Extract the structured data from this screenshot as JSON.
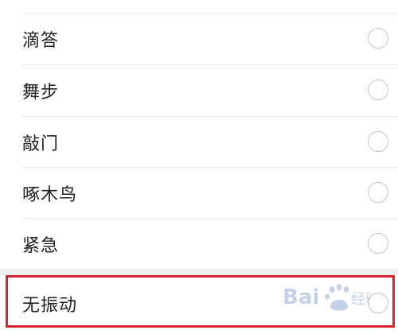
{
  "vibration_options": [
    {
      "label": "滴答",
      "selected": false
    },
    {
      "label": "舞步",
      "selected": false
    },
    {
      "label": "敲门",
      "selected": false
    },
    {
      "label": "啄木鸟",
      "selected": false
    },
    {
      "label": "紧急",
      "selected": false
    },
    {
      "label": "无振动",
      "selected": false
    }
  ],
  "highlight_color": "#d9232e",
  "watermark": {
    "text": "Bai经验",
    "icon": "baidu-paw-icon"
  }
}
